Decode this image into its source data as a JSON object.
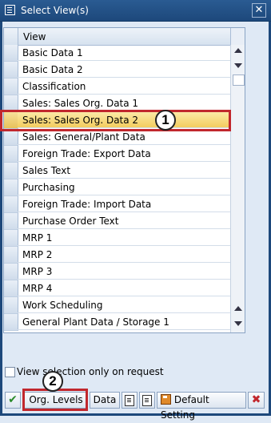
{
  "window": {
    "title": "Select View(s)"
  },
  "table": {
    "column_header": "View",
    "rows": [
      "Basic Data 1",
      "Basic Data 2",
      "Classification",
      "Sales: Sales Org. Data 1",
      "Sales: Sales Org. Data 2",
      "Sales: General/Plant Data",
      "Foreign Trade: Export Data",
      "Sales Text",
      "Purchasing",
      "Foreign Trade: Import Data",
      "Purchase Order Text",
      "MRP 1",
      "MRP 2",
      "MRP 3",
      "MRP 4",
      "Work Scheduling",
      "General Plant Data / Storage 1"
    ],
    "highlighted_row": "Sales: Sales Org. Data 2"
  },
  "callouts": {
    "one": "1",
    "two": "2"
  },
  "checkbox": {
    "label": "View selection only on request",
    "checked": false
  },
  "toolbar": {
    "org_levels_label": "Org. Levels",
    "data_label": "Data",
    "default_setting_label": "Default Setting"
  },
  "colors": {
    "title_bar": "#1d487b",
    "highlight": "#f3cd5f",
    "callout_red": "#c1272d"
  },
  "icons": [
    "select-view-icon",
    "close-icon",
    "scroll-up-icon",
    "scroll-down-icon",
    "check-icon",
    "select-all-icon",
    "deselect-all-icon",
    "save-icon",
    "cancel-icon"
  ]
}
